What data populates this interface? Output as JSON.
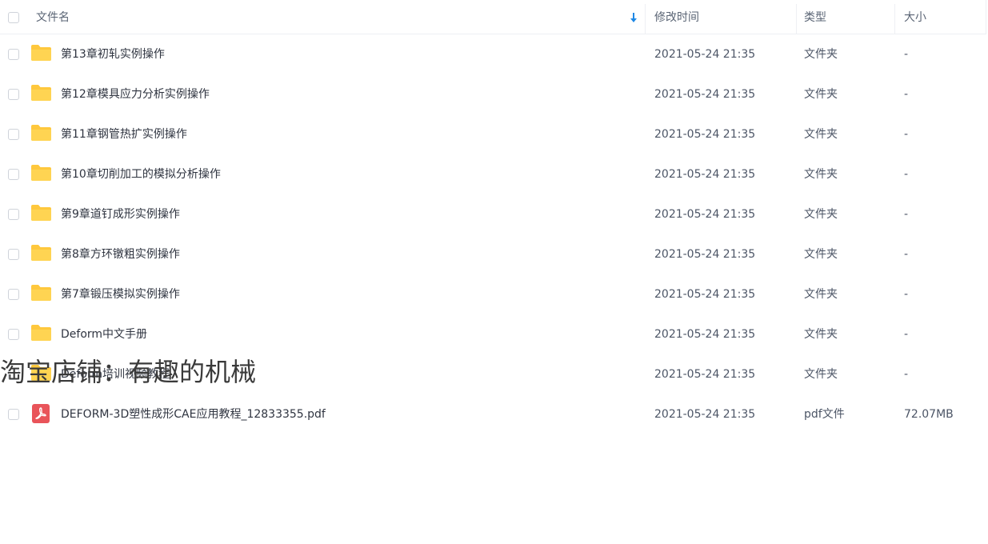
{
  "header": {
    "name": "文件名",
    "modified": "修改时间",
    "type": "类型",
    "size": "大小"
  },
  "rows": [
    {
      "name": "第13章初轧实例操作",
      "modified": "2021-05-24 21:35",
      "type": "文件夹",
      "size": "-",
      "icon": "folder-icon"
    },
    {
      "name": "第12章模具应力分析实例操作",
      "modified": "2021-05-24 21:35",
      "type": "文件夹",
      "size": "-",
      "icon": "folder-icon"
    },
    {
      "name": "第11章钢管热扩实例操作",
      "modified": "2021-05-24 21:35",
      "type": "文件夹",
      "size": "-",
      "icon": "folder-icon"
    },
    {
      "name": "第10章切削加工的模拟分析操作",
      "modified": "2021-05-24 21:35",
      "type": "文件夹",
      "size": "-",
      "icon": "folder-icon"
    },
    {
      "name": "第9章道钉成形实例操作",
      "modified": "2021-05-24 21:35",
      "type": "文件夹",
      "size": "-",
      "icon": "folder-icon"
    },
    {
      "name": "第8章方环镦粗实例操作",
      "modified": "2021-05-24 21:35",
      "type": "文件夹",
      "size": "-",
      "icon": "folder-icon"
    },
    {
      "name": "第7章锻压模拟实例操作",
      "modified": "2021-05-24 21:35",
      "type": "文件夹",
      "size": "-",
      "icon": "folder-icon"
    },
    {
      "name": "Deform中文手册",
      "modified": "2021-05-24 21:35",
      "type": "文件夹",
      "size": "-",
      "icon": "folder-icon"
    },
    {
      "name": "Deform培训视频教程",
      "modified": "2021-05-24 21:35",
      "type": "文件夹",
      "size": "-",
      "icon": "folder-icon"
    },
    {
      "name": "DEFORM-3D塑性成形CAE应用教程_12833355.pdf",
      "modified": "2021-05-24 21:35",
      "type": "pdf文件",
      "size": "72.07MB",
      "icon": "pdf-icon"
    }
  ],
  "watermark": "淘宝店铺：有趣的机械",
  "colors": {
    "folder": "#ffc83d",
    "pdf": "#e9545a",
    "sort_arrow": "#1e88e5"
  }
}
